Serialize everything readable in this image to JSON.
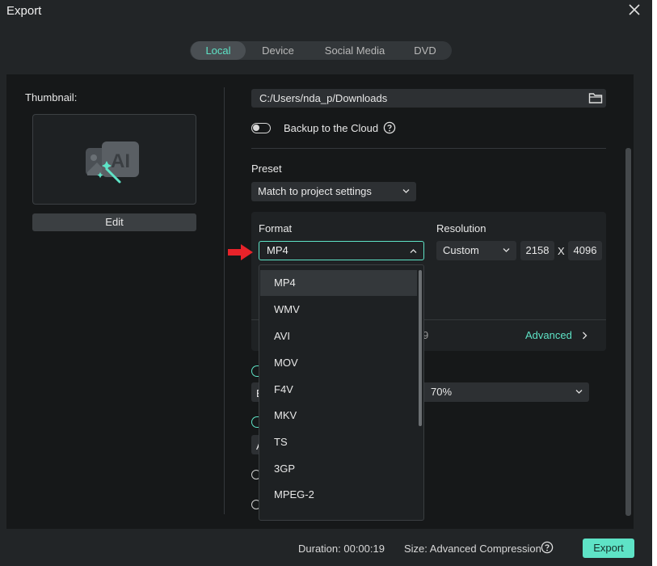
{
  "window": {
    "title": "Export"
  },
  "tabs": [
    {
      "label": "Local",
      "active": true
    },
    {
      "label": "Device",
      "active": false
    },
    {
      "label": "Social Media",
      "active": false
    },
    {
      "label": "DVD",
      "active": false
    }
  ],
  "thumbnail": {
    "label": "Thumbnail:",
    "edit_label": "Edit"
  },
  "output": {
    "path": "C:/Users/nda_p/Downloads",
    "backup_label": "Backup to the Cloud",
    "backup_enabled": false
  },
  "preset": {
    "label": "Preset",
    "value": "Match to project settings"
  },
  "format": {
    "label": "Format",
    "value": "MP4",
    "options": [
      "MP4",
      "WMV",
      "AVI",
      "MOV",
      "F4V",
      "MKV",
      "TS",
      "3GP",
      "MPEG-2"
    ],
    "selected_option": "MP4"
  },
  "resolution": {
    "label": "Resolution",
    "value": "Custom",
    "width": "2158",
    "separator": "X",
    "height": "4096"
  },
  "advanced": {
    "partial_text": "9",
    "label": "Advanced"
  },
  "quality": {
    "value": "70%"
  },
  "footer": {
    "duration": "Duration: 00:00:19",
    "size": "Size:  Advanced Compression",
    "export_label": "Export"
  },
  "colors": {
    "accent": "#5ee3c6",
    "background": "#222527",
    "panel": "#161819",
    "annotation_arrow": "#e8232a"
  },
  "annotations": {
    "pointer": "red-arrow pointing at format dropdown"
  },
  "partially_hidden": {
    "left_letters": [
      "E",
      "A"
    ]
  }
}
